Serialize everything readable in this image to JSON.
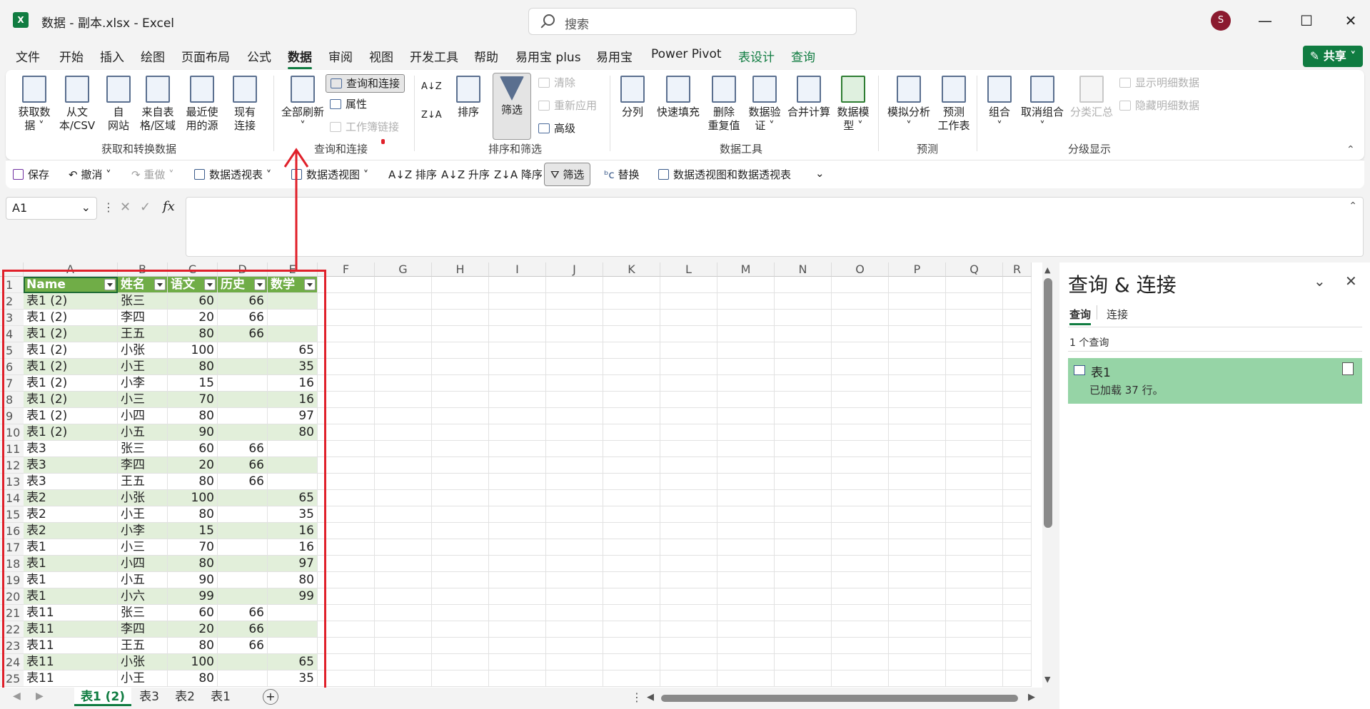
{
  "window": {
    "title": "数据 - 副本.xlsx  -  Excel",
    "app_icon": "excel-icon",
    "avatar_initial": "S",
    "minimize": "—",
    "maximize": "☐",
    "close": "✕"
  },
  "search": {
    "placeholder": "搜索"
  },
  "menu": {
    "tabs": [
      "文件",
      "开始",
      "插入",
      "绘图",
      "页面布局",
      "公式",
      "数据",
      "审阅",
      "视图",
      "开发工具",
      "帮助",
      "易用宝 plus",
      "易用宝",
      "Power Pivot",
      "表设计",
      "查询"
    ],
    "active": "数据",
    "share_label": "共享"
  },
  "ribbon": {
    "groups": {
      "get_transform": {
        "label": "获取和转换数据",
        "buttons": [
          "获取数\n据 ˅",
          "从文\n本/CSV",
          "自\n网站",
          "来自表\n格/区域",
          "最近使\n用的源",
          "现有\n连接"
        ]
      },
      "query_conn": {
        "label": "查询和连接",
        "refresh_all": "全部刷新\n˅",
        "small": [
          "查询和连接",
          "属性",
          "工作簿链接"
        ]
      },
      "sort_filter": {
        "label": "排序和筛选",
        "sort": "排序",
        "filter": "筛选",
        "small": [
          "清除",
          "重新应用",
          "高级"
        ]
      },
      "data_tools": {
        "label": "数据工具",
        "buttons": [
          "分列",
          "快速填充",
          "删除\n重复值",
          "数据验\n证 ˅",
          "合并计算",
          "数据模\n型 ˅"
        ]
      },
      "forecast": {
        "label": "预测",
        "buttons": [
          "模拟分析\n˅",
          "预测\n工作表"
        ]
      },
      "outline": {
        "label": "分级显示",
        "buttons": [
          "组合\n˅",
          "取消组合\n˅",
          "分类汇总"
        ],
        "small": [
          "显示明细数据",
          "隐藏明细数据"
        ]
      }
    }
  },
  "qat": {
    "items": [
      "保存",
      "撤消",
      "重做",
      "数据透视表",
      "数据透视图",
      "排序",
      "升序",
      "降序",
      "筛选",
      "替换",
      "数据透视图和数据透视表"
    ]
  },
  "formula": {
    "namebox": "A1",
    "fx": "fx",
    "cancel": "✕",
    "enter": "✓"
  },
  "grid": {
    "columns": [
      "A",
      "B",
      "C",
      "D",
      "E",
      "F",
      "G",
      "H",
      "I",
      "J",
      "K",
      "L",
      "M",
      "N",
      "O",
      "P",
      "Q",
      "R"
    ],
    "headers": [
      "Name",
      "姓名",
      "语文",
      "历史",
      "数学"
    ],
    "rows": [
      [
        "表1 (2)",
        "张三",
        "60",
        "66",
        ""
      ],
      [
        "表1 (2)",
        "李四",
        "20",
        "66",
        ""
      ],
      [
        "表1 (2)",
        "王五",
        "80",
        "66",
        ""
      ],
      [
        "表1 (2)",
        "小张",
        "100",
        "",
        "65"
      ],
      [
        "表1 (2)",
        "小王",
        "80",
        "",
        "35"
      ],
      [
        "表1 (2)",
        "小李",
        "15",
        "",
        "16"
      ],
      [
        "表1 (2)",
        "小三",
        "70",
        "",
        "16"
      ],
      [
        "表1 (2)",
        "小四",
        "80",
        "",
        "97"
      ],
      [
        "表1 (2)",
        "小五",
        "90",
        "",
        "80"
      ],
      [
        "表3",
        "张三",
        "60",
        "66",
        ""
      ],
      [
        "表3",
        "李四",
        "20",
        "66",
        ""
      ],
      [
        "表3",
        "王五",
        "80",
        "66",
        ""
      ],
      [
        "表2",
        "小张",
        "100",
        "",
        "65"
      ],
      [
        "表2",
        "小王",
        "80",
        "",
        "35"
      ],
      [
        "表2",
        "小李",
        "15",
        "",
        "16"
      ],
      [
        "表1",
        "小三",
        "70",
        "",
        "16"
      ],
      [
        "表1",
        "小四",
        "80",
        "",
        "97"
      ],
      [
        "表1",
        "小五",
        "90",
        "",
        "80"
      ],
      [
        "表1",
        "小六",
        "99",
        "",
        "99"
      ],
      [
        "表11",
        "张三",
        "60",
        "66",
        ""
      ],
      [
        "表11",
        "李四",
        "20",
        "66",
        ""
      ],
      [
        "表11",
        "王五",
        "80",
        "66",
        ""
      ],
      [
        "表11",
        "小张",
        "100",
        "",
        "65"
      ],
      [
        "表11",
        "小王",
        "80",
        "",
        "35"
      ]
    ]
  },
  "sheets": {
    "tabs": [
      "表1 (2)",
      "表3",
      "表2",
      "表1"
    ],
    "active": "表1 (2)",
    "add": "+"
  },
  "pane": {
    "title": "查询 & 连接",
    "tabs": [
      "查询",
      "连接"
    ],
    "count": "1 个查询",
    "query": {
      "name": "表1",
      "status": "已加载 37 行。"
    }
  },
  "colors": {
    "accent": "#107c41",
    "table_header": "#70ad47",
    "band": "#e2efda",
    "annotation": "#e0202a",
    "query_card": "#96d4a6"
  }
}
